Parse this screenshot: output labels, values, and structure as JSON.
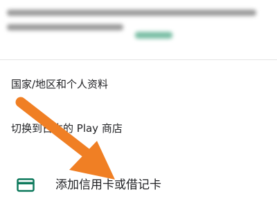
{
  "menu": {
    "country_profile": "国家/地区和个人资料",
    "switch_store": "切换到日本的 Play 商店"
  },
  "payment": {
    "add_card_label": "添加信用卡或借记卡",
    "card_icon": "credit-card-icon"
  },
  "colors": {
    "arrow": "#f07f24",
    "card_icon": "#0f7a5d",
    "text": "#202124"
  }
}
